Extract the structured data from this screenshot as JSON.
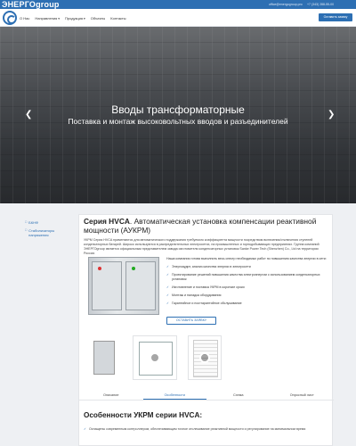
{
  "topbar": {
    "brand": "ЭНЕРГОgroup",
    "email": "office@energogroup.pro",
    "phone": "+7 (343) 288-55-00"
  },
  "nav": {
    "items": [
      "О Нас",
      "Направления",
      "Продукция",
      "Объекты",
      "Контакты"
    ],
    "cta": "Оставить заявку"
  },
  "hero": {
    "title": "Вводы трансформаторные",
    "subtitle": "Поставка и монтаж высоковольтных вводов и разъединителей"
  },
  "sidebar": {
    "items": [
      "БКНФ",
      "Стабилизаторы напряжения"
    ]
  },
  "product": {
    "title_bold": "Серия HVCA",
    "title_rest": ". Автоматическая установка компенсации реактивной мощности (АУКРМ)",
    "intro": "УКРМ Серия HVCA применяются для автоматического поддержания требуемого коэффициента мощности посредством включения/отключения ступеней конденсаторных батарей. Широко используются в распределительных электросетях, на промышленных и горнодобывающих предприятиях. Группа компаний ЭНЕРГОgroup является официальным представителем завода изготовителя конденсаторных установок Sanke Power Tech (Shenzhen) Co., Ltd на территории России.",
    "features_lead": "Наша компания готова выполнить весь спектр необходимых работ по повышению качества энергии в сети:",
    "features": [
      "Энергоаудит, анализ качества энергии в электросети",
      "Проектирование решений повышения качества электроэнергии с использованием конденсаторных установок",
      "Изготовление и поставка УКРМ в короткие сроки",
      "Монтаж и наладка оборудования",
      "Гарантийное и постгарантийное обслуживание"
    ],
    "order_button": "ОСТАВИТЬ ЗАЯВКУ"
  },
  "tabs": [
    "Описание",
    "Особенности",
    "Схема",
    "Опросный лист"
  ],
  "active_tab": "Особенности",
  "features_section": {
    "title": "Особенности УКРМ серии HVCA:",
    "items": [
      "Оснащены современным контроллером, обеспечивающим точное отслеживание реактивной мощности и регулирование на минимальном время"
    ]
  },
  "colors": {
    "accent": "#2d6fb3"
  },
  "icons": {
    "sidebar_item": "square-icon",
    "list_check": "check-icon",
    "prev": "chevron-left-icon",
    "next": "chevron-right-icon"
  }
}
